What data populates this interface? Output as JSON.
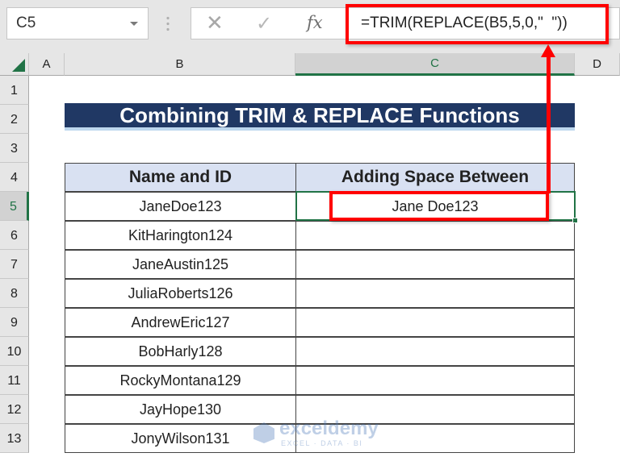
{
  "formula_bar": {
    "name_box": "C5",
    "cancel_icon": "✕",
    "enter_icon": "✓",
    "insert_function_icon": "fx",
    "formula": "=TRIM(REPLACE(B5,5,0,\"  \"))"
  },
  "columns": [
    {
      "label": "A",
      "selected": false
    },
    {
      "label": "B",
      "selected": false
    },
    {
      "label": "C",
      "selected": true
    },
    {
      "label": "D",
      "selected": false
    }
  ],
  "rows": [
    "1",
    "2",
    "3",
    "4",
    "5",
    "6",
    "7",
    "8",
    "9",
    "10",
    "11",
    "12",
    "13"
  ],
  "selected_row": "5",
  "sheet": {
    "title": "Combining TRIM & REPLACE Functions",
    "headers": [
      "Name and ID",
      "Adding Space Between"
    ],
    "data": [
      [
        "JaneDoe123",
        "Jane Doe123"
      ],
      [
        "KitHarington124",
        ""
      ],
      [
        "JaneAustin125",
        ""
      ],
      [
        "JuliaRoberts126",
        ""
      ],
      [
        "AndrewEric127",
        ""
      ],
      [
        "BobHarly128",
        ""
      ],
      [
        "RockyMontana129",
        ""
      ],
      [
        "JayHope130",
        ""
      ],
      [
        "JonyWilson131",
        ""
      ]
    ]
  },
  "annotation": {
    "highlight_color": "#ff0000",
    "active_cell_color": "#217346"
  },
  "watermark": {
    "name": "exceldemy",
    "tagline": "EXCEL · DATA · BI"
  }
}
